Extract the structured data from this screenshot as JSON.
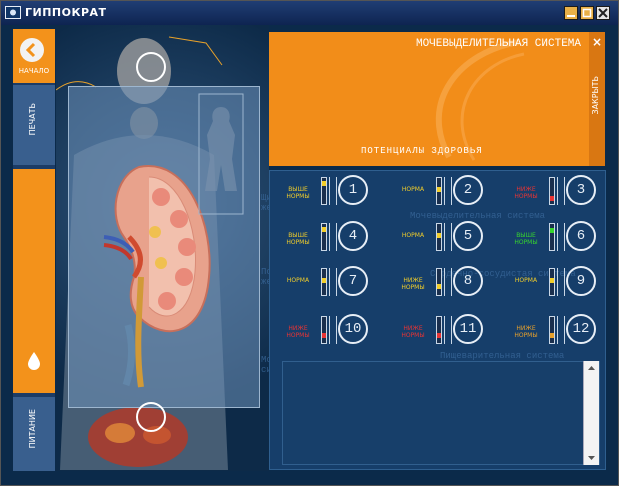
{
  "window": {
    "title": "ГИППОКРАТ",
    "icon": "app-icon",
    "controls": {
      "minimize": "minimize-icon",
      "maximize": "maximize-icon",
      "close": "close-icon"
    }
  },
  "sidebar": {
    "back_label": "НАЧАЛО",
    "print_label": "ПЕЧАТЬ",
    "diet_label": "ПИТАНИЕ",
    "drop_icon": "drop-icon"
  },
  "scene": {
    "labels": [
      "Щитовидная железа",
      "Поджелудочная железа",
      "Мочевыделительная система",
      "Сердечно-сосудистая система",
      "Пищеварительная система"
    ]
  },
  "right_panel": {
    "system_title": "МОЧЕВЫДЕЛИТЕЛЬНАЯ СИСТЕМА",
    "potentials_title": "ПОТЕНЦИАЛЫ ЗДОРОВЬЯ",
    "side_strip_label": "ЗАКРЫТЬ",
    "close_symbol": "×",
    "indicators": [
      {
        "num": "1",
        "label": "ВЫШЕ НОРМЫ",
        "color": "#f2ce2a",
        "fill": 0.85
      },
      {
        "num": "2",
        "label": "НОРМА",
        "color": "#f2ce2a",
        "fill": 0.55
      },
      {
        "num": "3",
        "label": "НИЖЕ НОРМЫ",
        "color": "#e83434",
        "fill": 0.15
      },
      {
        "num": "4",
        "label": "ВЫШЕ НОРМЫ",
        "color": "#f2ce2a",
        "fill": 0.85
      },
      {
        "num": "5",
        "label": "НОРМА",
        "color": "#f2ce2a",
        "fill": 0.55
      },
      {
        "num": "6",
        "label": "ВЫШЕ НОРМЫ",
        "color": "#37d52e",
        "fill": 0.8
      },
      {
        "num": "7",
        "label": "НОРМА",
        "color": "#f2ce2a",
        "fill": 0.55
      },
      {
        "num": "8",
        "label": "НИЖЕ НОРМЫ",
        "color": "#f2ce2a",
        "fill": 0.3
      },
      {
        "num": "9",
        "label": "НОРМА",
        "color": "#f2ce2a",
        "fill": 0.55
      },
      {
        "num": "10",
        "label": "НИЖЕ НОРМЫ",
        "color": "#e83434",
        "fill": 0.25
      },
      {
        "num": "11",
        "label": "НИЖЕ НОРМЫ",
        "color": "#e83434",
        "fill": 0.25
      },
      {
        "num": "12",
        "label": "НИЖЕ НОРМЫ",
        "color": "#e8a12c",
        "fill": 0.25
      }
    ]
  },
  "textbox": {
    "scroll_up": "scroll-up-icon",
    "scroll_down": "scroll-down-icon"
  }
}
